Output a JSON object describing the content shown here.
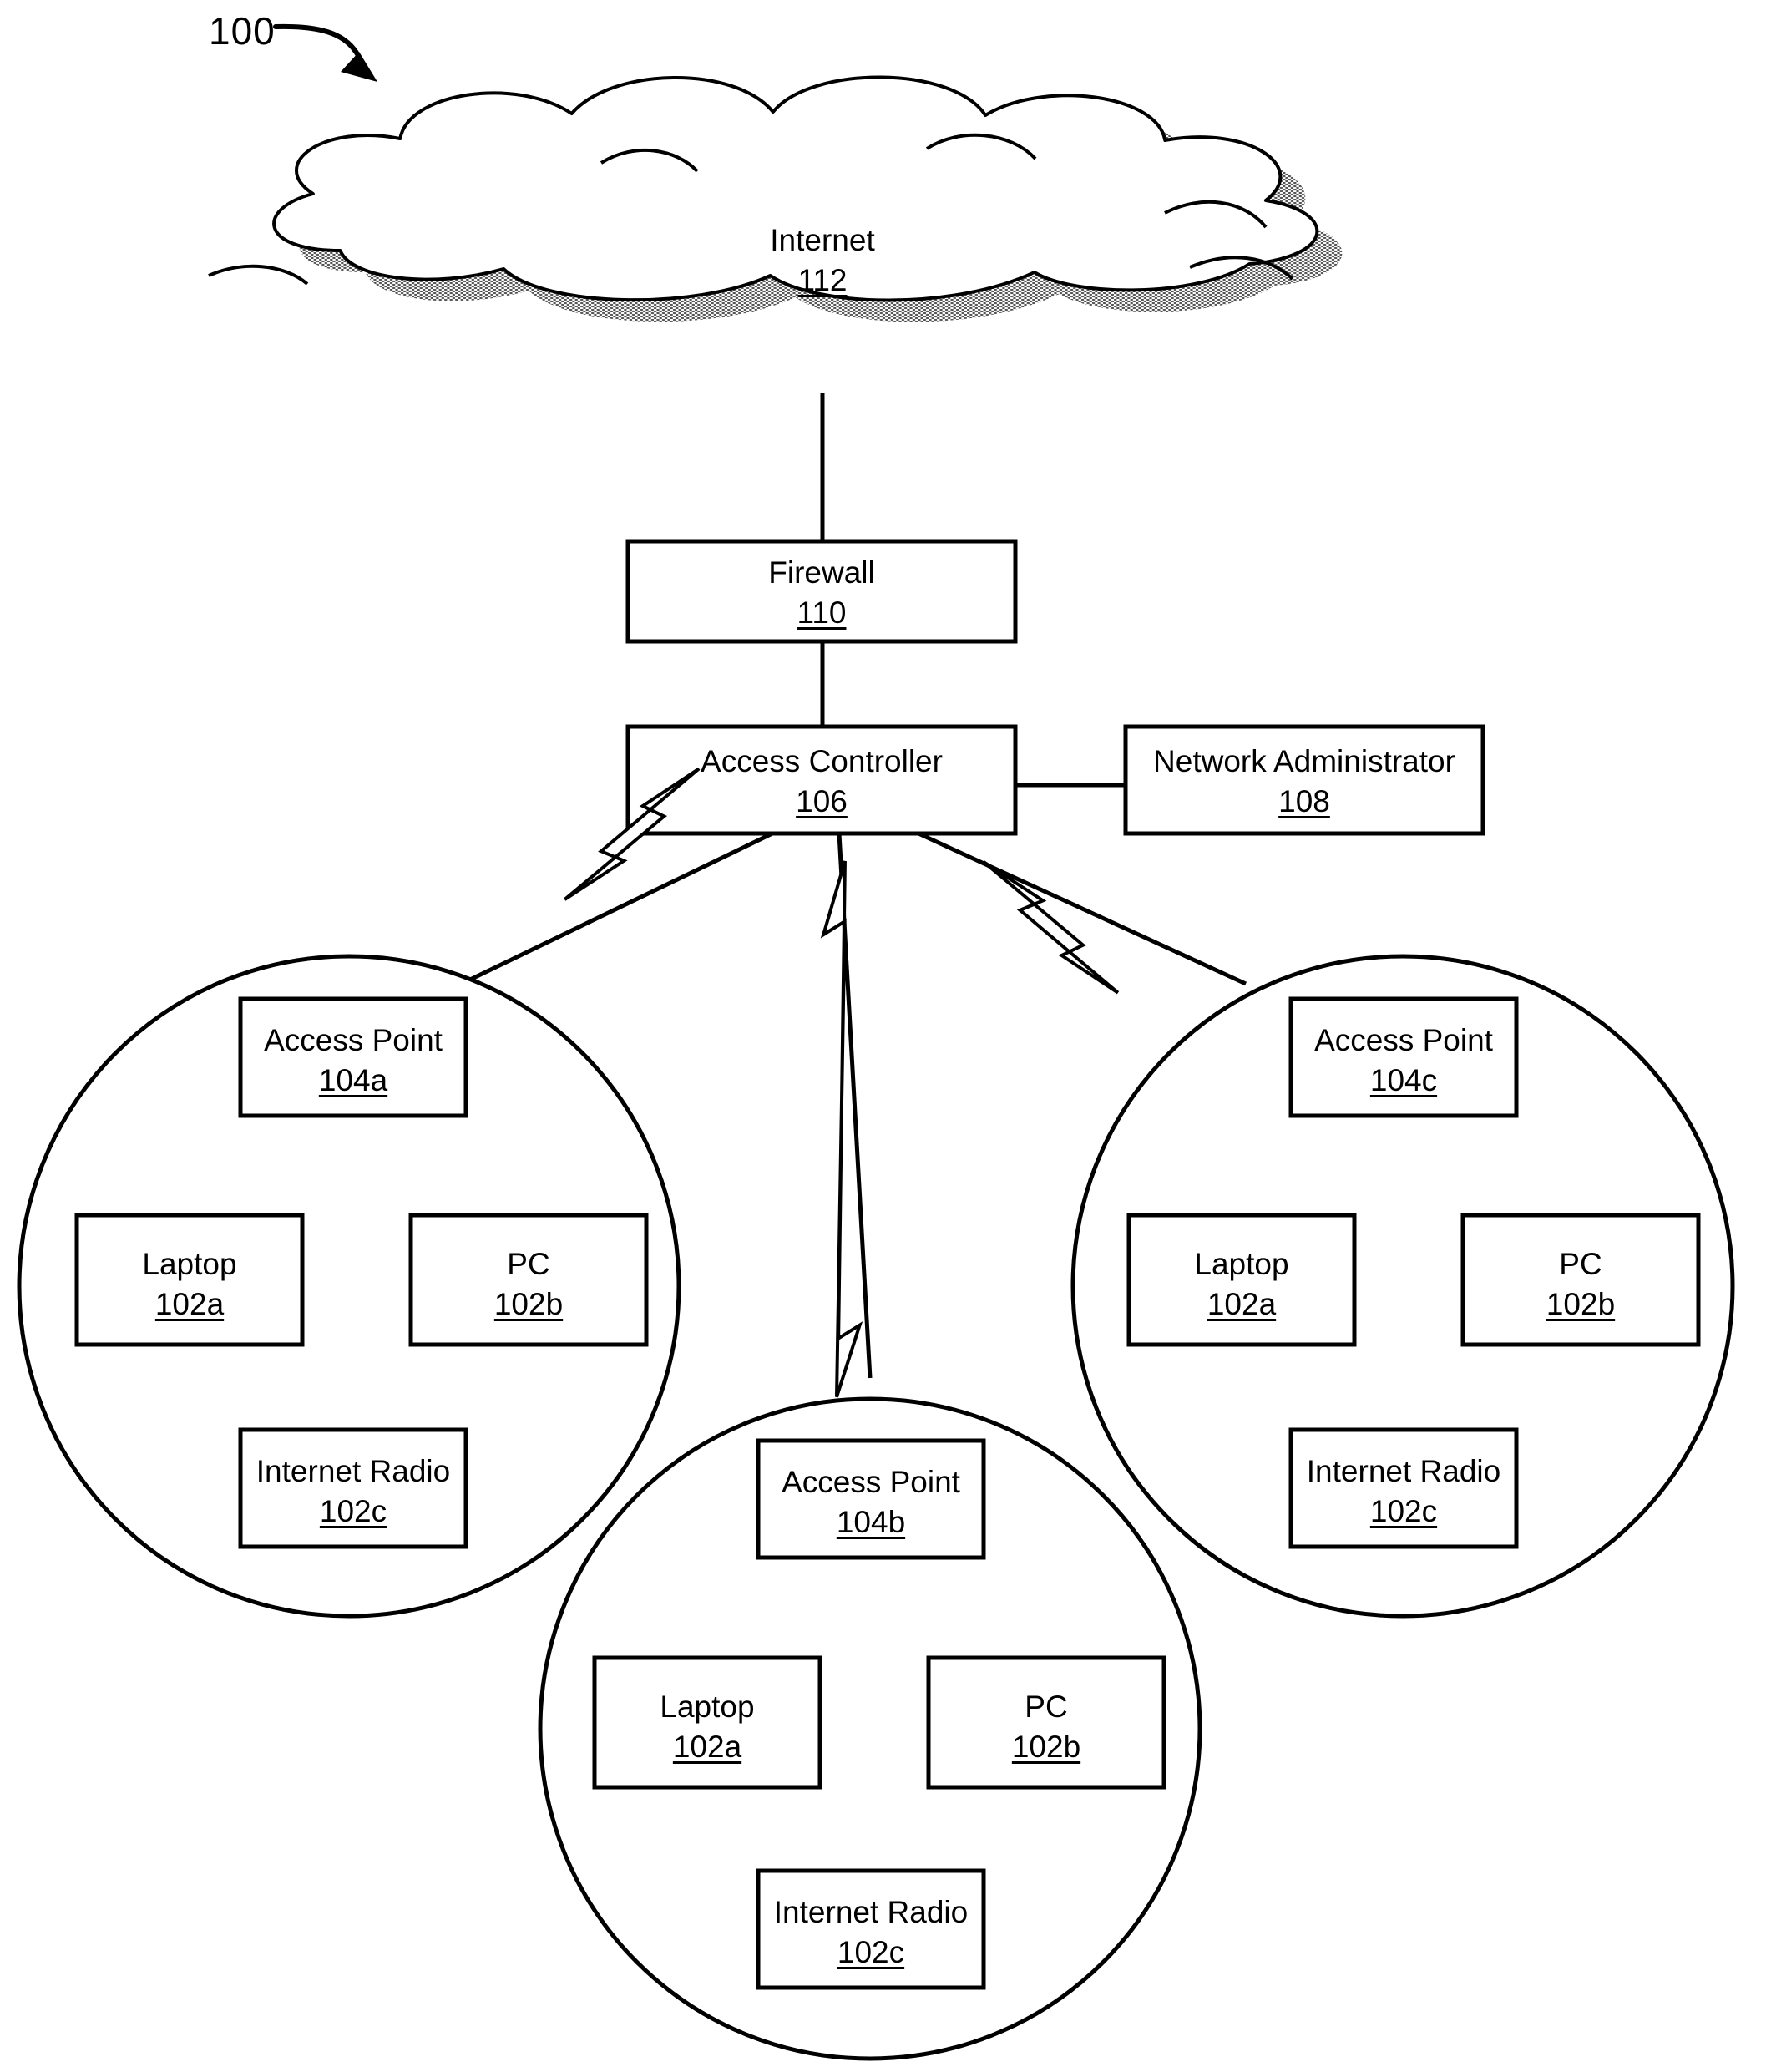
{
  "figure": {
    "number": "100",
    "arrow_icon": "curved-arrow-icon"
  },
  "nodes": {
    "internet": {
      "name": "Internet",
      "ref": "112",
      "shape": "cloud"
    },
    "firewall": {
      "name": "Firewall",
      "ref": "110",
      "shape": "rect"
    },
    "access_controller": {
      "name": "Access Controller",
      "ref": "106",
      "shape": "rect"
    },
    "network_administrator": {
      "name": "Network Administrator",
      "ref": "108",
      "shape": "rect"
    }
  },
  "cells": [
    {
      "id": "cell-left",
      "shape": "circle",
      "access_point": {
        "name": "Access Point",
        "ref": "104a"
      },
      "devices": [
        {
          "name": "Laptop",
          "ref": "102a"
        },
        {
          "name": "PC",
          "ref": "102b"
        },
        {
          "name": "Internet Radio",
          "ref": "102c"
        }
      ]
    },
    {
      "id": "cell-bottom",
      "shape": "circle",
      "access_point": {
        "name": "Access Point",
        "ref": "104b"
      },
      "devices": [
        {
          "name": "Laptop",
          "ref": "102a"
        },
        {
          "name": "PC",
          "ref": "102b"
        },
        {
          "name": "Internet Radio",
          "ref": "102c"
        }
      ]
    },
    {
      "id": "cell-right",
      "shape": "circle",
      "access_point": {
        "name": "Access Point",
        "ref": "104c"
      },
      "devices": [
        {
          "name": "Laptop",
          "ref": "102a"
        },
        {
          "name": "PC",
          "ref": "102b"
        },
        {
          "name": "Internet Radio",
          "ref": "102c"
        }
      ]
    }
  ],
  "links": [
    {
      "from": "internet",
      "to": "firewall",
      "style": "solid-line"
    },
    {
      "from": "firewall",
      "to": "access_controller",
      "style": "solid-line"
    },
    {
      "from": "access_controller",
      "to": "network_administrator",
      "style": "solid-line"
    },
    {
      "from": "access_controller",
      "to": "cell-left",
      "style": "wireless-lightning"
    },
    {
      "from": "access_controller",
      "to": "cell-bottom",
      "style": "wireless-lightning"
    },
    {
      "from": "access_controller",
      "to": "cell-right",
      "style": "wireless-lightning"
    }
  ],
  "colors": {
    "stroke": "#000000",
    "fill": "#ffffff",
    "cloud_shadow": "#9a9a9a"
  }
}
